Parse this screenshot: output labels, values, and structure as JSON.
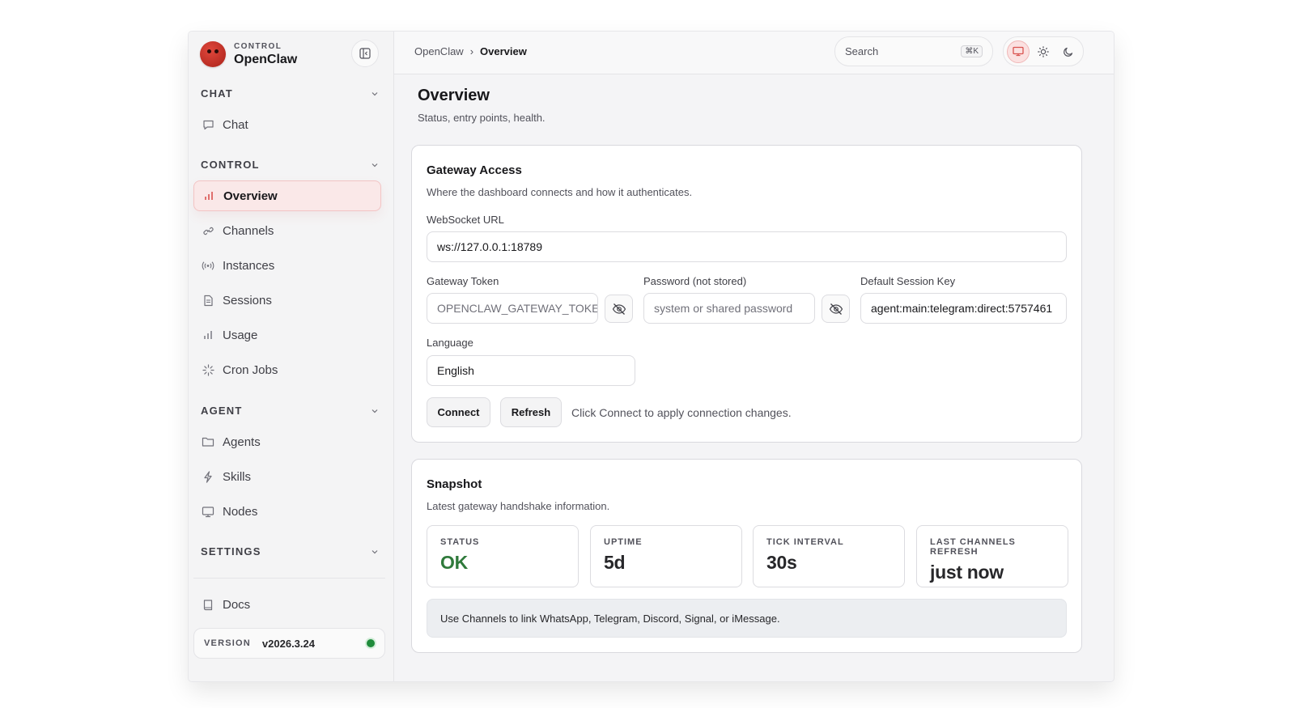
{
  "brand": {
    "kicker": "CONTROL",
    "name": "OpenClaw"
  },
  "sidebar": {
    "sections": [
      {
        "label": "CHAT",
        "items": [
          {
            "label": "Chat",
            "icon": "chat-bubble-icon"
          }
        ]
      },
      {
        "label": "CONTROL",
        "items": [
          {
            "label": "Overview",
            "icon": "bar-chart-icon",
            "active": true
          },
          {
            "label": "Channels",
            "icon": "link-icon"
          },
          {
            "label": "Instances",
            "icon": "radio-icon"
          },
          {
            "label": "Sessions",
            "icon": "document-icon"
          },
          {
            "label": "Usage",
            "icon": "bar-chart-icon"
          },
          {
            "label": "Cron Jobs",
            "icon": "loader-icon"
          }
        ]
      },
      {
        "label": "AGENT",
        "items": [
          {
            "label": "Agents",
            "icon": "folder-icon"
          },
          {
            "label": "Skills",
            "icon": "lightning-icon"
          },
          {
            "label": "Nodes",
            "icon": "monitor-icon"
          }
        ]
      },
      {
        "label": "SETTINGS",
        "items": []
      }
    ],
    "docs": {
      "label": "Docs",
      "icon": "book-icon"
    },
    "version": {
      "label": "VERSION",
      "value": "v2026.3.24",
      "status_color": "#1f8b3b"
    }
  },
  "topbar": {
    "breadcrumb": {
      "root": "OpenClaw",
      "separator": "›",
      "current": "Overview"
    },
    "search": {
      "placeholder": "Search",
      "shortcut": "⌘K"
    },
    "theme_buttons": [
      "monitor-icon",
      "sun-icon",
      "moon-icon"
    ]
  },
  "page": {
    "title": "Overview",
    "subtitle": "Status, entry points, health."
  },
  "gateway": {
    "title": "Gateway Access",
    "subtitle": "Where the dashboard connects and how it authenticates.",
    "websocket_label": "WebSocket URL",
    "websocket_value": "ws://127.0.0.1:18789",
    "token_label": "Gateway Token",
    "token_placeholder": "OPENCLAW_GATEWAY_TOKE",
    "password_label": "Password (not stored)",
    "password_placeholder": "system or shared password",
    "session_label": "Default Session Key",
    "session_value": "agent:main:telegram:direct:5757461",
    "language_label": "Language",
    "language_value": "English",
    "connect_label": "Connect",
    "refresh_label": "Refresh",
    "hint": "Click Connect to apply connection changes."
  },
  "snapshot": {
    "title": "Snapshot",
    "subtitle": "Latest gateway handshake information.",
    "stats": [
      {
        "label": "STATUS",
        "value": "OK"
      },
      {
        "label": "UPTIME",
        "value": "5d"
      },
      {
        "label": "TICK INTERVAL",
        "value": "30s"
      },
      {
        "label": "LAST CHANNELS REFRESH",
        "value": "just now"
      }
    ],
    "note": "Use Channels to link WhatsApp, Telegram, Discord, Signal, or iMessage."
  },
  "colors": {
    "accent": "#d9534f",
    "ok": "#2f7a3b"
  }
}
